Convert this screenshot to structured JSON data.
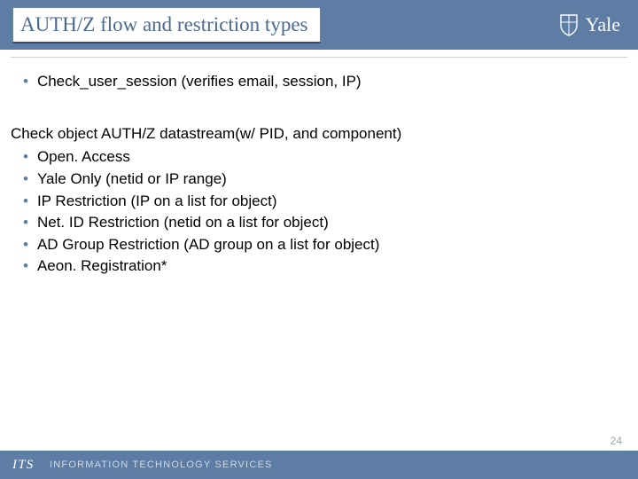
{
  "slide": {
    "title": "AUTH/Z flow and restriction types",
    "brand": "Yale",
    "main_bullet": "Check_user_session (verifies email, session, IP)",
    "sub_heading": "Check object AUTH/Z datastream(w/ PID, and component)",
    "sub_bullets": {
      "b0": "Open. Access",
      "b1": "Yale Only (netid or IP range)",
      "b2": "IP Restriction (IP on a list for object)",
      "b3": "Net. ID Restriction (netid on a list for object)",
      "b4": "AD Group Restriction (AD group on a list for object)",
      "b5": "Aeon. Registration*"
    },
    "footer_text": "INFORMATION TECHNOLOGY SERVICES",
    "footer_brand": "ITS",
    "page_number": "24"
  }
}
